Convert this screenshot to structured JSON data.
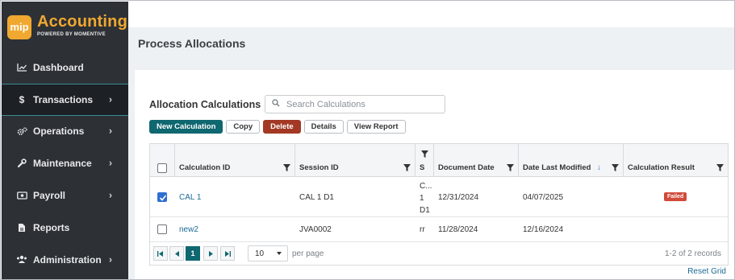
{
  "brand": {
    "badge": "mip",
    "title": "Accounting",
    "subtitle": "POWERED BY MOMENTIVE",
    "color": "#f0a830"
  },
  "sidebar": {
    "items": [
      {
        "label": "Dashboard",
        "icon": "chart-line-icon",
        "chevron": false,
        "active": false
      },
      {
        "label": "Transactions",
        "icon": "dollar-icon",
        "chevron": true,
        "active": true
      },
      {
        "label": "Operations",
        "icon": "gears-icon",
        "chevron": true,
        "active": false
      },
      {
        "label": "Maintenance",
        "icon": "wrench-icon",
        "chevron": true,
        "active": false
      },
      {
        "label": "Payroll",
        "icon": "money-icon",
        "chevron": true,
        "active": false
      },
      {
        "label": "Reports",
        "icon": "document-icon",
        "chevron": false,
        "active": false
      },
      {
        "label": "Administration",
        "icon": "users-icon",
        "chevron": true,
        "active": false
      }
    ]
  },
  "page": {
    "title": "Process Allocations"
  },
  "section": {
    "title": "Allocation Calculations",
    "separator": "|",
    "search_placeholder": "Search Calculations"
  },
  "toolbar": {
    "new_label": "New Calculation",
    "copy_label": "Copy",
    "delete_label": "Delete",
    "details_label": "Details",
    "view_report_label": "View Report"
  },
  "grid": {
    "columns": {
      "calculation_id": "Calculation ID",
      "session_id": "Session ID",
      "s": "S",
      "document_date": "Document Date",
      "date_last_modified": "Date Last Modified",
      "calculation_result": "Calculation Result"
    },
    "sort_indicator": "↓",
    "rows": [
      {
        "checked": true,
        "calculation_id": "CAL 1",
        "session_id": "CAL 1 D1",
        "s_line1": "C...",
        "s_line2": "1",
        "s_line3": "D1",
        "document_date": "12/31/2024",
        "date_last_modified": "04/07/2025",
        "result": "Failed"
      },
      {
        "checked": false,
        "calculation_id": "new2",
        "session_id": "JVA0002",
        "s_line1": "rr",
        "document_date": "11/28/2024",
        "date_last_modified": "12/16/2024",
        "result": ""
      }
    ]
  },
  "pager": {
    "first": "⏮",
    "prev": "◀",
    "current_page": "1",
    "next": "▶",
    "last": "⏭",
    "page_size": "10",
    "per_page_label": "per page",
    "records_label": "1-2 of 2 records"
  },
  "reset_grid_label": "Reset Grid",
  "colors": {
    "sidebar_bg": "#2d3136",
    "primary": "#0f6770",
    "danger": "#a33924",
    "failed": "#d14a3a",
    "link": "#1b6a95"
  }
}
